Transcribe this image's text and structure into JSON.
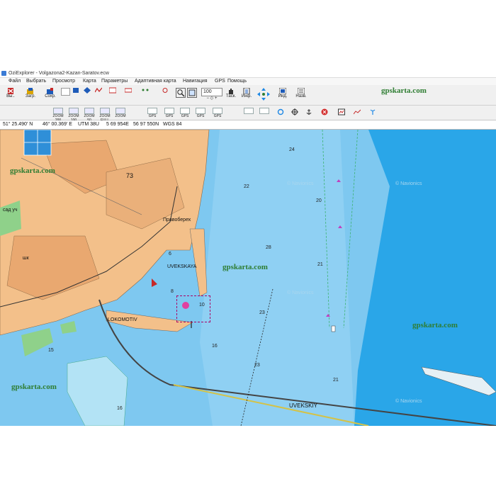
{
  "watermark": "gpskarta.com",
  "window": {
    "title": "OziExplorer - Volgazona2-Kazan-Saratov.ecw"
  },
  "menu": [
    "Файл",
    "Выбрать",
    "Просмотр",
    "Карта",
    "Параметры",
    "Адаптивная карта",
    "Навигация",
    "GPS",
    "Помощь"
  ],
  "toolbar1": {
    "exit_label": "Вы..",
    "load_label": "Загр.",
    "save_label": "Сохр.",
    "zoom_value": "100",
    "drag_label": "Таск.",
    "info_label": "Инф.",
    "ind_label": "Инд.",
    "names_label": "Назв."
  },
  "toolbar2": {
    "zoom_buttons": [
      "ZOOM 200",
      "ZOOM 100",
      "ZOOM 50",
      "ZOOM FULL",
      "ZOOM"
    ],
    "gps_label": "GPS"
  },
  "status": {
    "lat": "51° 25.490' N",
    "lon": "46° 00.369' E",
    "utm": "UTM  38U",
    "east": "5 69 954E",
    "north": "56 97 550N",
    "datum": "WGS 84"
  },
  "map": {
    "city_block": "73",
    "places": [
      "Правоберех",
      "UVEKSKAYA",
      "LOKOMOTIV",
      "UVEKSKIY",
      "сад уч",
      "шк"
    ],
    "depths": [
      "24",
      "22",
      "20",
      "28",
      "21",
      "23",
      "23",
      "16",
      "21",
      "10",
      "6",
      "8",
      "15",
      "16"
    ],
    "faint_watermark": "© Navionics"
  },
  "colors": {
    "deep_water": "#2aa6e8",
    "shallow_water": "#7ec8f0",
    "land": "#f3c08a",
    "channel": "#3cb371"
  }
}
